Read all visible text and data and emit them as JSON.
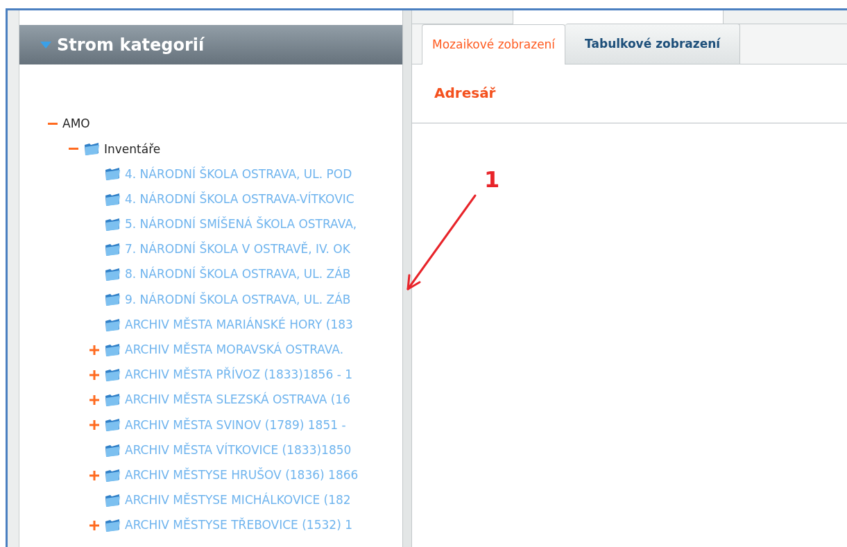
{
  "left_panel": {
    "title": "Strom kategorií",
    "expanded": true,
    "tree": [
      {
        "label": "AMO",
        "kind": "root",
        "expanded": true,
        "children": [
          {
            "label": "Inventáře",
            "kind": "folder",
            "expanded": true,
            "children": [
              {
                "label": "4. NÁRODNÍ ŠKOLA OSTRAVA, UL. POD",
                "kind": "link"
              },
              {
                "label": "4. NÁRODNÍ ŠKOLA OSTRAVA-VÍTKOVIC",
                "kind": "link"
              },
              {
                "label": "5. NÁRODNÍ SMÍŠENÁ ŠKOLA OSTRAVA,",
                "kind": "link"
              },
              {
                "label": "7. NÁRODNÍ ŠKOLA V OSTRAVĚ, IV. OK",
                "kind": "link"
              },
              {
                "label": "8. NÁRODNÍ ŠKOLA OSTRAVA, UL. ZÁB",
                "kind": "link"
              },
              {
                "label": "9. NÁRODNÍ ŠKOLA OSTRAVA, UL. ZÁB",
                "kind": "link"
              },
              {
                "label": "ARCHIV MĚSTA MARIÁNSKÉ HORY (183",
                "kind": "link"
              },
              {
                "label": "ARCHIV MĚSTA MORAVSKÁ OSTRAVA.",
                "kind": "link",
                "expanded": false
              },
              {
                "label": "ARCHIV MĚSTA PŘÍVOZ (1833)1856 - 1",
                "kind": "link",
                "expanded": false
              },
              {
                "label": "ARCHIV MĚSTA SLEZSKÁ OSTRAVA (16",
                "kind": "link",
                "expanded": false
              },
              {
                "label": "ARCHIV MĚSTA SVINOV (1789) 1851 -",
                "kind": "link",
                "expanded": false
              },
              {
                "label": "ARCHIV MĚSTA VÍTKOVICE (1833)1850",
                "kind": "link"
              },
              {
                "label": "ARCHIV MĚSTYSE HRUŠOV (1836) 1866",
                "kind": "link",
                "expanded": false
              },
              {
                "label": "ARCHIV MĚSTYSE MICHÁLKOVICE (182",
                "kind": "link"
              },
              {
                "label": "ARCHIV MĚSTYSE TŘEBOVICE (1532) 1",
                "kind": "link",
                "expanded": false
              }
            ]
          }
        ]
      }
    ]
  },
  "right_panel": {
    "tabs": [
      {
        "label": "Mozaikové zobrazení",
        "selected": true
      },
      {
        "label": "Tabulkové zobrazení",
        "selected": false
      }
    ],
    "heading": "Adresář"
  },
  "annotation": {
    "label": "1"
  }
}
